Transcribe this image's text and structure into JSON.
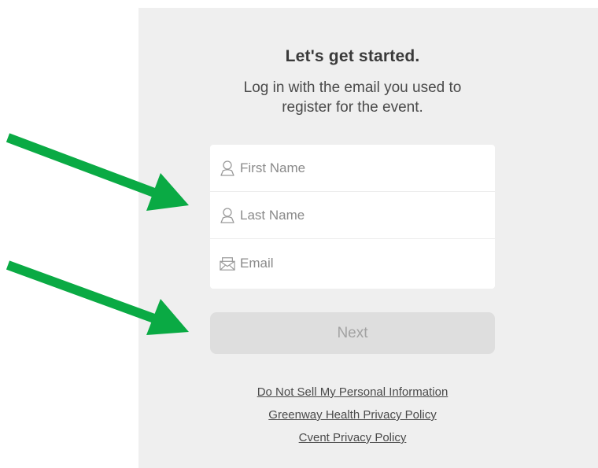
{
  "header": {
    "title": "Let's get started.",
    "subtitle_line1": "Log in with the email you used to",
    "subtitle_line2": "register for the event."
  },
  "form": {
    "first_name_placeholder": "First Name",
    "last_name_placeholder": "Last Name",
    "email_placeholder": "Email",
    "first_name_value": "",
    "last_name_value": "",
    "email_value": ""
  },
  "next_button": {
    "label": "Next"
  },
  "footer_links": [
    "Do Not Sell My Personal Information",
    "Greenway Health Privacy Policy",
    "Cvent Privacy Policy"
  ],
  "colors": {
    "panel_background": "#efefef",
    "arrow": "#0aaa44",
    "button_background": "#dedede",
    "button_text": "#a2a2a2"
  },
  "icons": {
    "first_name": "user-icon",
    "last_name": "user-icon",
    "email": "envelope-icon"
  }
}
